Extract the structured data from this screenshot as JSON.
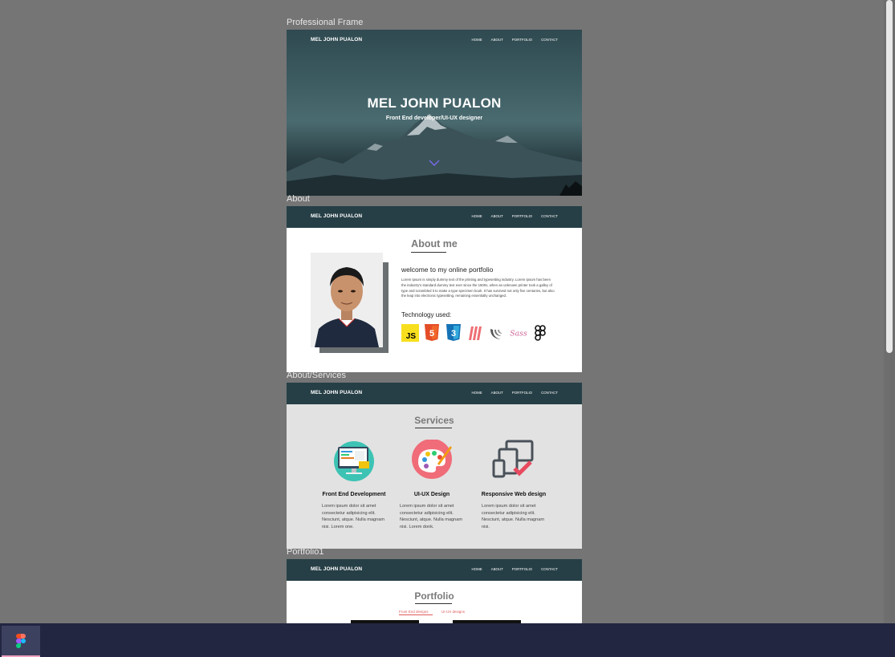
{
  "labels": {
    "hero": "Professional Frame",
    "about": "About",
    "services": "About/Services",
    "portfolio": "Portfolio1"
  },
  "nav": {
    "brand": "MEL JOHN PUALON",
    "links": [
      "HOME",
      "ABOUT",
      "PORTFOLIO",
      "CONTACT"
    ]
  },
  "hero": {
    "title": "MEL JOHN PUALON",
    "subtitle": "Front End developer/UI-UX designer"
  },
  "about": {
    "heading": "About me",
    "welcome": "welcome to my online portfolio",
    "body": "Lorem Ipsum is simply dummy text of the printing and typesetting industry. Lorem Ipsum has been the industry's standard dummy text ever since the 1500s, when an unknown printer took a galley of type and scrambled it to make a type specimen book. It has survived not only five centuries, but also the leap into electronic typesetting, remaining essentially unchanged.",
    "tech_heading": "Technology used:",
    "tech_icons": [
      "js-icon",
      "html5-icon",
      "css3-icon",
      "materialize-icon",
      "jquery-icon",
      "sass-icon",
      "figma-icon"
    ],
    "js_text": "JS",
    "html_text": "5",
    "css_text": "3",
    "sass_text": "Sass"
  },
  "services": {
    "heading": "Services",
    "items": [
      {
        "name": "Front End Development",
        "desc": "Lorem ipsum dolor sit amet consectetur adipisicing elit. Nesciunt, atque. Nulla magnam nisi. Lorem one.",
        "icon": "monitor-icon"
      },
      {
        "name": "UI-UX Design",
        "desc": "Lorem ipsum dolor sit amet consectetur adipisicing elit. Nesciunt, atque. Nulla magnam nisi. Lorem donk.",
        "icon": "palette-icon"
      },
      {
        "name": "Responsive Web design",
        "desc": "Lorem ipsum dolor sit amet consectetur adipisicing elit. Nesciunt, atque. Nulla magnam nisi.",
        "icon": "devices-icon"
      }
    ]
  },
  "portfolio": {
    "heading": "Portfolio",
    "tabs": [
      "Front End designs",
      "UI-UX designs"
    ]
  },
  "colors": {
    "nav": "#263f46",
    "canvas": "#757575",
    "taskbar": "#222641",
    "accent": "#e05a5a"
  },
  "taskbar": {
    "app_icon": "figma-icon"
  }
}
